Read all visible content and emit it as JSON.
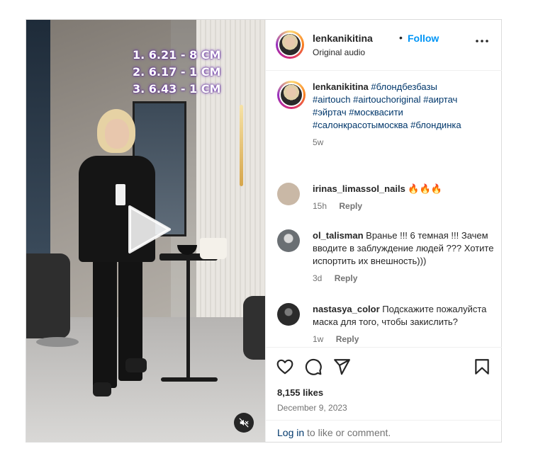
{
  "post": {
    "overlay_lines": [
      "1. 6.21 - 8 CM",
      "2. 6.17 - 1 CM",
      "3. 6.43 - 1 CM"
    ]
  },
  "header": {
    "username": "lenkanikitina",
    "separator": "•",
    "follow_label": "Follow",
    "audio_label": "Original audio",
    "more_label": "•••"
  },
  "caption": {
    "username": "lenkanikitina",
    "tags": [
      "#блондбезбазы",
      "#airtouch",
      "#airtouchoriginal",
      "#аиртач",
      "#эйртач",
      "#москвасити",
      "#салонкрасотымосква",
      "#блондинка"
    ],
    "time": "5w"
  },
  "comments": [
    {
      "username": "irinas_limassol_nails",
      "text": "🔥🔥🔥",
      "time": "15h",
      "reply_label": "Reply",
      "avatar_color": "#c9b8a6"
    },
    {
      "username": "ol_talisman",
      "text": "Вранье !!! 6 темная !!! Зачем вводите в заблуждение людей ??? Хотите испортить их внешность)))",
      "time": "3d",
      "reply_label": "Reply",
      "avatar_color": "#6a6f73"
    },
    {
      "username": "nastasya_color",
      "text": "Подскажите пожалуйста маска для того, чтобы закислить?",
      "time": "1w",
      "reply_label": "Reply",
      "avatar_color": "#2b2b2b"
    }
  ],
  "actions": {
    "icons": [
      "heart-icon",
      "comment-icon",
      "share-icon",
      "bookmark-icon"
    ],
    "likes": "8,155 likes",
    "date": "December 9, 2023",
    "login_link": "Log in",
    "login_rest": " to like or comment."
  },
  "colors": {
    "accent": "#0095f6",
    "hashtag": "#00376b",
    "muted": "#737373"
  }
}
